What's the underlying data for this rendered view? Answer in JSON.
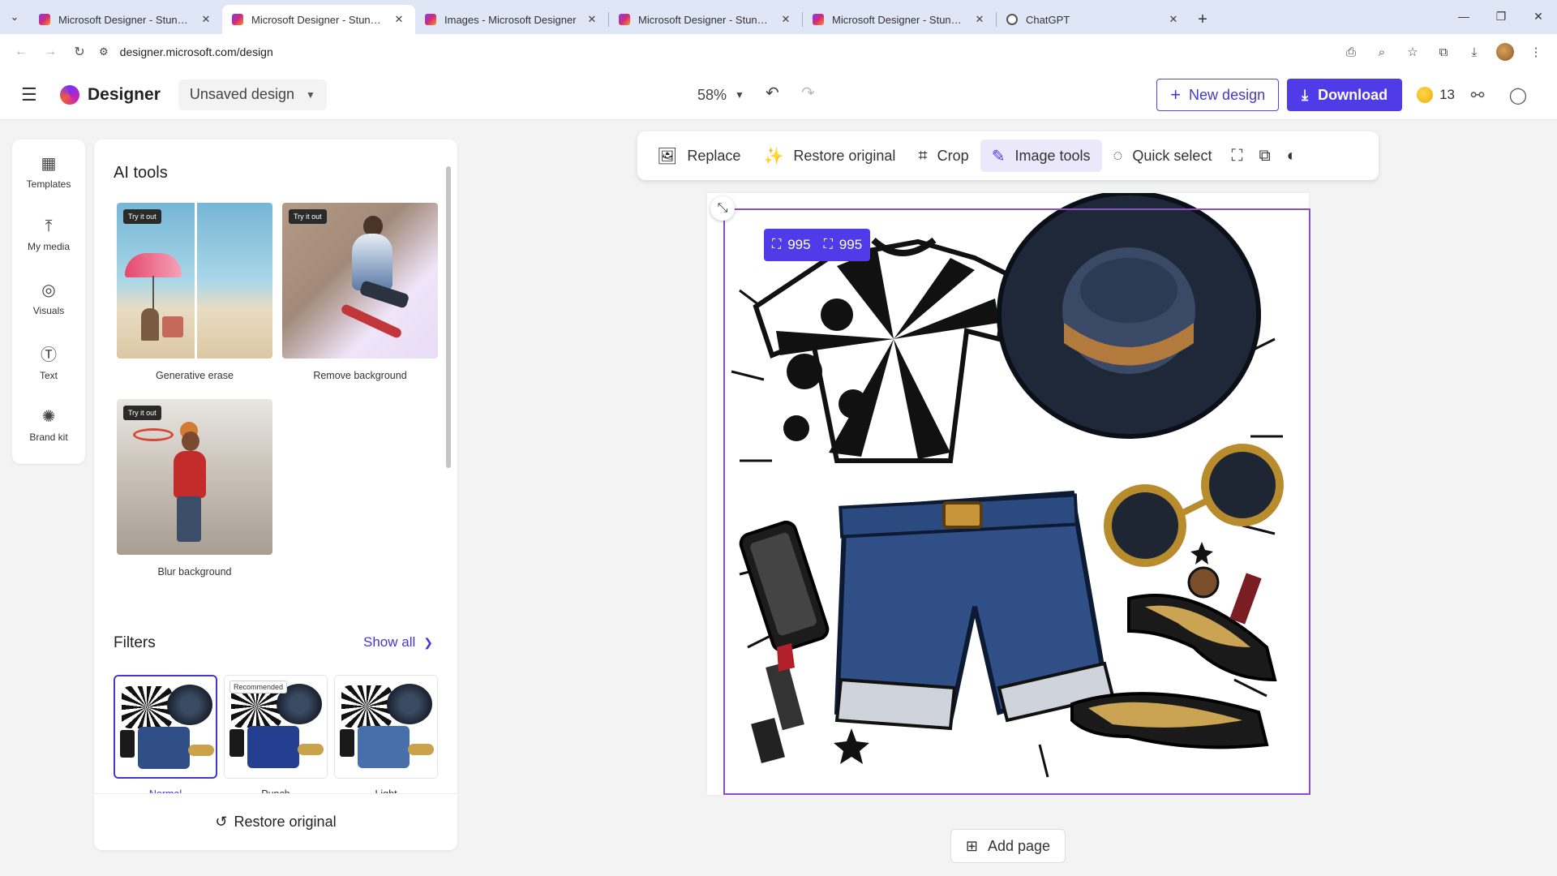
{
  "browser": {
    "tabs": [
      {
        "title": "Microsoft Designer - Stunning",
        "active": false,
        "icon": "designer-favicon"
      },
      {
        "title": "Microsoft Designer - Stunning",
        "active": true,
        "icon": "designer-favicon"
      },
      {
        "title": "Images - Microsoft Designer",
        "active": false,
        "icon": "designer-favicon"
      },
      {
        "title": "Microsoft Designer - Stunning",
        "active": false,
        "icon": "designer-favicon"
      },
      {
        "title": "Microsoft Designer - Stunning",
        "active": false,
        "icon": "designer-favicon"
      },
      {
        "title": "ChatGPT",
        "active": false,
        "icon": "chatgpt-favicon"
      }
    ],
    "url": "designer.microsoft.com/design"
  },
  "app": {
    "brand": "Designer",
    "doc_name": "Unsaved design",
    "zoom": "58%",
    "new_design_label": "New design",
    "download_label": "Download",
    "credits": "13",
    "accent": "#4f3ce8"
  },
  "rail": {
    "items": [
      {
        "label": "Templates",
        "icon": "templates-icon"
      },
      {
        "label": "My media",
        "icon": "upload-icon"
      },
      {
        "label": "Visuals",
        "icon": "visuals-icon"
      },
      {
        "label": "Text",
        "icon": "text-icon"
      },
      {
        "label": "Brand kit",
        "icon": "palette-icon"
      }
    ]
  },
  "panel": {
    "title": "AI tools",
    "tools": [
      {
        "label": "Generative erase",
        "badge": "Try it out"
      },
      {
        "label": "Remove background",
        "badge": "Try it out"
      },
      {
        "label": "Blur background",
        "badge": "Try it out"
      }
    ],
    "filters_title": "Filters",
    "show_all": "Show all",
    "filters": [
      {
        "label": "Normal",
        "selected": true
      },
      {
        "label": "Punch",
        "badge": "Recommended",
        "selected": false
      },
      {
        "label": "Light",
        "selected": false
      }
    ],
    "restore_label": "Restore original"
  },
  "image_toolbar": {
    "replace": "Replace",
    "restore": "Restore original",
    "crop": "Crop",
    "image_tools": "Image tools",
    "quick_select": "Quick select"
  },
  "canvas": {
    "width_value": "995",
    "height_value": "995",
    "add_page": "Add page"
  }
}
